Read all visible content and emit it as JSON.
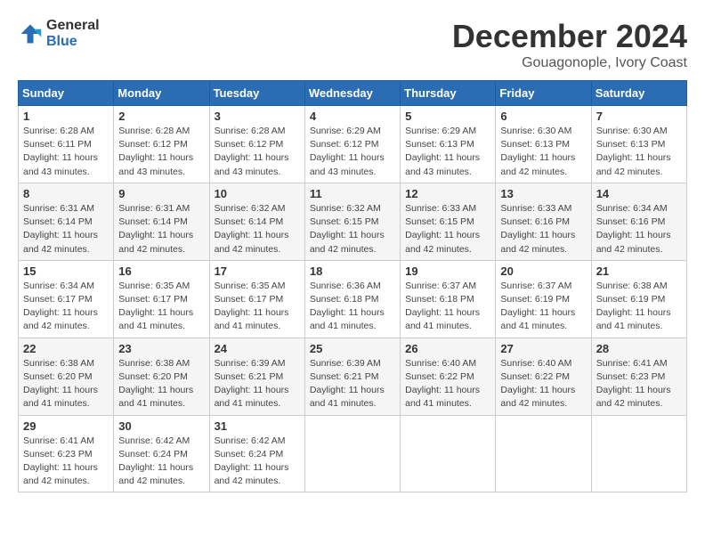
{
  "logo": {
    "general": "General",
    "blue": "Blue"
  },
  "title": "December 2024",
  "location": "Gouagonople, Ivory Coast",
  "weekdays": [
    "Sunday",
    "Monday",
    "Tuesday",
    "Wednesday",
    "Thursday",
    "Friday",
    "Saturday"
  ],
  "weeks": [
    [
      {
        "day": "1",
        "sunrise": "6:28 AM",
        "sunset": "6:11 PM",
        "daylight": "11 hours and 43 minutes."
      },
      {
        "day": "2",
        "sunrise": "6:28 AM",
        "sunset": "6:12 PM",
        "daylight": "11 hours and 43 minutes."
      },
      {
        "day": "3",
        "sunrise": "6:28 AM",
        "sunset": "6:12 PM",
        "daylight": "11 hours and 43 minutes."
      },
      {
        "day": "4",
        "sunrise": "6:29 AM",
        "sunset": "6:12 PM",
        "daylight": "11 hours and 43 minutes."
      },
      {
        "day": "5",
        "sunrise": "6:29 AM",
        "sunset": "6:13 PM",
        "daylight": "11 hours and 43 minutes."
      },
      {
        "day": "6",
        "sunrise": "6:30 AM",
        "sunset": "6:13 PM",
        "daylight": "11 hours and 42 minutes."
      },
      {
        "day": "7",
        "sunrise": "6:30 AM",
        "sunset": "6:13 PM",
        "daylight": "11 hours and 42 minutes."
      }
    ],
    [
      {
        "day": "8",
        "sunrise": "6:31 AM",
        "sunset": "6:14 PM",
        "daylight": "11 hours and 42 minutes."
      },
      {
        "day": "9",
        "sunrise": "6:31 AM",
        "sunset": "6:14 PM",
        "daylight": "11 hours and 42 minutes."
      },
      {
        "day": "10",
        "sunrise": "6:32 AM",
        "sunset": "6:14 PM",
        "daylight": "11 hours and 42 minutes."
      },
      {
        "day": "11",
        "sunrise": "6:32 AM",
        "sunset": "6:15 PM",
        "daylight": "11 hours and 42 minutes."
      },
      {
        "day": "12",
        "sunrise": "6:33 AM",
        "sunset": "6:15 PM",
        "daylight": "11 hours and 42 minutes."
      },
      {
        "day": "13",
        "sunrise": "6:33 AM",
        "sunset": "6:16 PM",
        "daylight": "11 hours and 42 minutes."
      },
      {
        "day": "14",
        "sunrise": "6:34 AM",
        "sunset": "6:16 PM",
        "daylight": "11 hours and 42 minutes."
      }
    ],
    [
      {
        "day": "15",
        "sunrise": "6:34 AM",
        "sunset": "6:17 PM",
        "daylight": "11 hours and 42 minutes."
      },
      {
        "day": "16",
        "sunrise": "6:35 AM",
        "sunset": "6:17 PM",
        "daylight": "11 hours and 41 minutes."
      },
      {
        "day": "17",
        "sunrise": "6:35 AM",
        "sunset": "6:17 PM",
        "daylight": "11 hours and 41 minutes."
      },
      {
        "day": "18",
        "sunrise": "6:36 AM",
        "sunset": "6:18 PM",
        "daylight": "11 hours and 41 minutes."
      },
      {
        "day": "19",
        "sunrise": "6:37 AM",
        "sunset": "6:18 PM",
        "daylight": "11 hours and 41 minutes."
      },
      {
        "day": "20",
        "sunrise": "6:37 AM",
        "sunset": "6:19 PM",
        "daylight": "11 hours and 41 minutes."
      },
      {
        "day": "21",
        "sunrise": "6:38 AM",
        "sunset": "6:19 PM",
        "daylight": "11 hours and 41 minutes."
      }
    ],
    [
      {
        "day": "22",
        "sunrise": "6:38 AM",
        "sunset": "6:20 PM",
        "daylight": "11 hours and 41 minutes."
      },
      {
        "day": "23",
        "sunrise": "6:38 AM",
        "sunset": "6:20 PM",
        "daylight": "11 hours and 41 minutes."
      },
      {
        "day": "24",
        "sunrise": "6:39 AM",
        "sunset": "6:21 PM",
        "daylight": "11 hours and 41 minutes."
      },
      {
        "day": "25",
        "sunrise": "6:39 AM",
        "sunset": "6:21 PM",
        "daylight": "11 hours and 41 minutes."
      },
      {
        "day": "26",
        "sunrise": "6:40 AM",
        "sunset": "6:22 PM",
        "daylight": "11 hours and 41 minutes."
      },
      {
        "day": "27",
        "sunrise": "6:40 AM",
        "sunset": "6:22 PM",
        "daylight": "11 hours and 42 minutes."
      },
      {
        "day": "28",
        "sunrise": "6:41 AM",
        "sunset": "6:23 PM",
        "daylight": "11 hours and 42 minutes."
      }
    ],
    [
      {
        "day": "29",
        "sunrise": "6:41 AM",
        "sunset": "6:23 PM",
        "daylight": "11 hours and 42 minutes."
      },
      {
        "day": "30",
        "sunrise": "6:42 AM",
        "sunset": "6:24 PM",
        "daylight": "11 hours and 42 minutes."
      },
      {
        "day": "31",
        "sunrise": "6:42 AM",
        "sunset": "6:24 PM",
        "daylight": "11 hours and 42 minutes."
      },
      null,
      null,
      null,
      null
    ]
  ],
  "labels": {
    "sunrise": "Sunrise:",
    "sunset": "Sunset:",
    "daylight": "Daylight:"
  }
}
